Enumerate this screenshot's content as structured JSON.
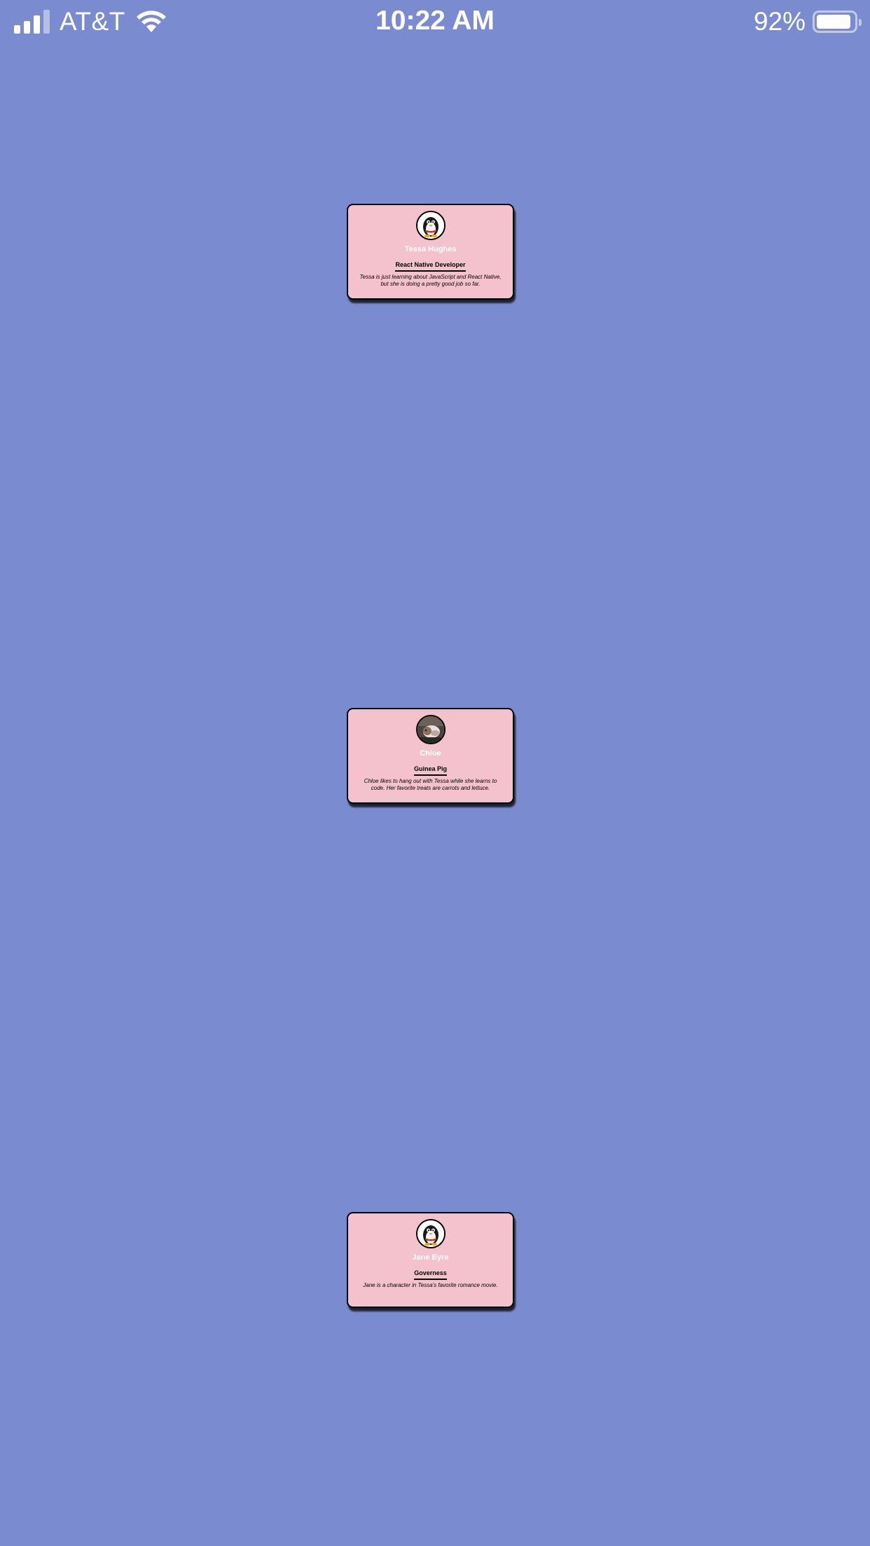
{
  "status_bar": {
    "carrier": "AT&T",
    "time": "10:22 AM",
    "battery_percent": "92%",
    "battery_level": 0.92,
    "signal_bars_filled": 3,
    "signal_bars_total": 4
  },
  "colors": {
    "background": "#7a8bcf",
    "card": "#f4c2cc"
  },
  "cards": [
    {
      "name": "Tessa Hughes",
      "title": "React Native Developer",
      "description": "Tessa is just learning about JavaScript and React Native, but she is doing a pretty good job so far.",
      "avatar": "penguin-avatar"
    },
    {
      "name": "Chloe",
      "title": "Guinea Pig",
      "description": "Chloe likes to hang out with Tessa while she learns to code. Her favorite treats are carrots and lettuce.",
      "avatar": "guinea-pig-photo"
    },
    {
      "name": "Jane Eyre",
      "title": "Governess",
      "description": "Jane is a character in Tessa's favorite romance movie.",
      "avatar": "penguin-avatar"
    }
  ]
}
